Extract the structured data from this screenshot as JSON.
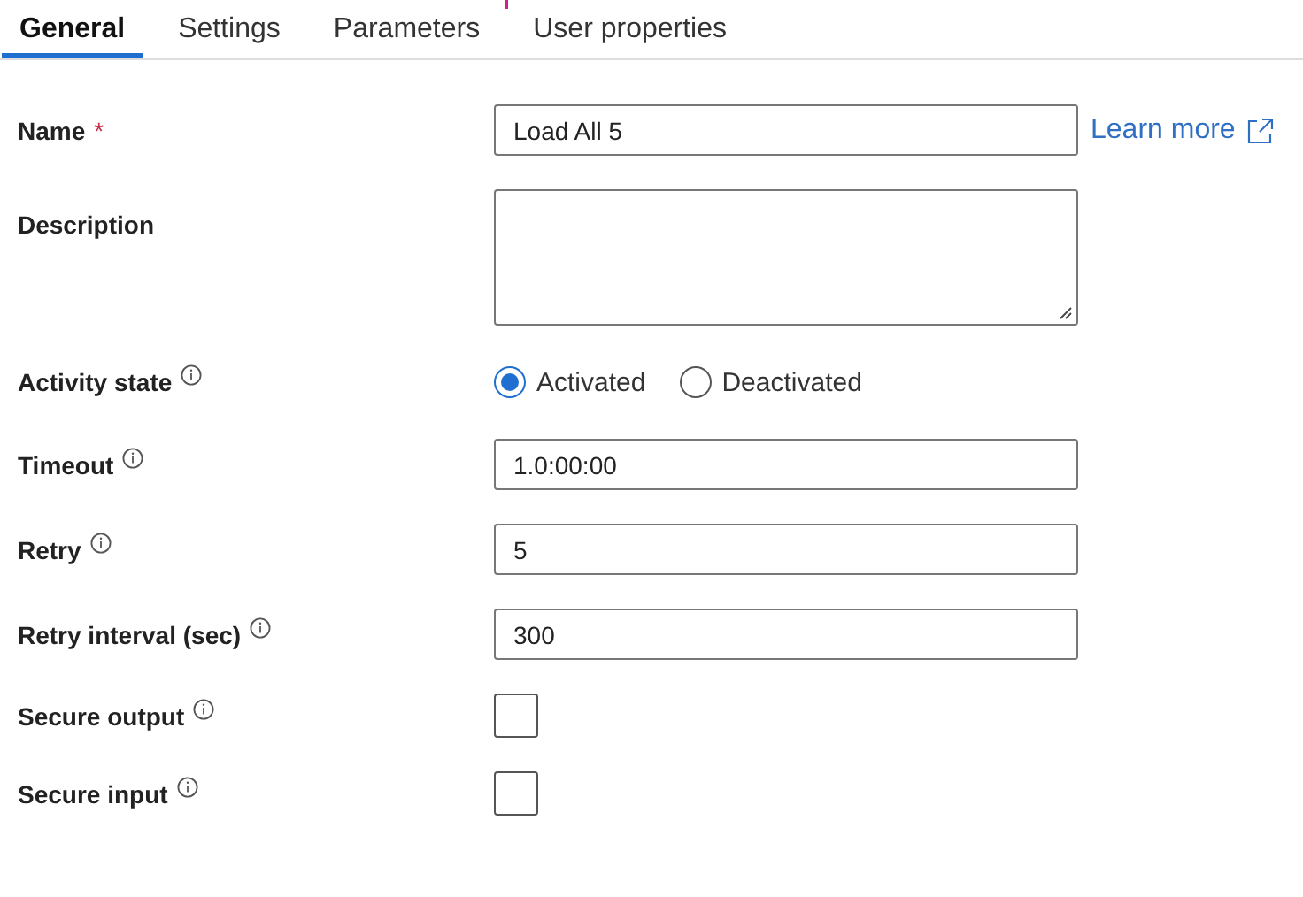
{
  "tabs": [
    {
      "label": "General",
      "selected": true
    },
    {
      "label": "Settings",
      "selected": false
    },
    {
      "label": "Parameters",
      "selected": false
    },
    {
      "label": "User properties",
      "selected": false
    }
  ],
  "fields": [
    {
      "kind": "text",
      "label": "Name",
      "required_mark": "*",
      "info": false,
      "value": "Load All 5",
      "link": "Learn more"
    },
    {
      "kind": "textarea",
      "label": "Description",
      "info": false
    },
    {
      "kind": "radio",
      "label": "Activity state",
      "info": true,
      "options": [
        {
          "label": "Activated",
          "selected": true
        },
        {
          "label": "Deactivated",
          "selected": false
        }
      ]
    },
    {
      "kind": "text",
      "label": "Timeout",
      "info": true,
      "value": "1.0:00:00"
    },
    {
      "kind": "text",
      "label": "Retry",
      "info": true,
      "value": "5"
    },
    {
      "kind": "text",
      "label": "Retry interval (sec)",
      "info": true,
      "value": "300"
    },
    {
      "kind": "checkbox",
      "label": "Secure output",
      "info": true,
      "checked": false
    },
    {
      "kind": "checkbox",
      "label": "Secure input",
      "info": true,
      "checked": false
    }
  ]
}
